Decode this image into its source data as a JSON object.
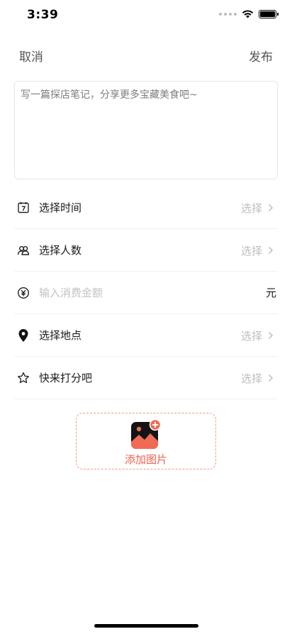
{
  "status_bar": {
    "time": "3:39"
  },
  "nav": {
    "cancel_label": "取消",
    "publish_label": "发布"
  },
  "note": {
    "placeholder": "写一篇探店笔记，分享更多宝藏美食吧~",
    "value": ""
  },
  "form": {
    "time": {
      "label": "选择时间",
      "action": "选择",
      "icon": "calendar-icon"
    },
    "people": {
      "label": "选择人数",
      "action": "选择",
      "icon": "people-icon"
    },
    "amount": {
      "placeholder": "输入消费金额",
      "unit": "元",
      "icon": "yen-icon"
    },
    "location": {
      "label": "选择地点",
      "action": "选择",
      "icon": "location-pin-icon"
    },
    "rating": {
      "label": "快来打分吧",
      "action": "选择",
      "icon": "star-icon"
    }
  },
  "upload": {
    "label": "添加图片",
    "icon": "add-image-icon"
  },
  "colors": {
    "accent": "#ef5f4a",
    "dashed_border": "#f19a86",
    "placeholder_gray": "#c2c2c2"
  }
}
